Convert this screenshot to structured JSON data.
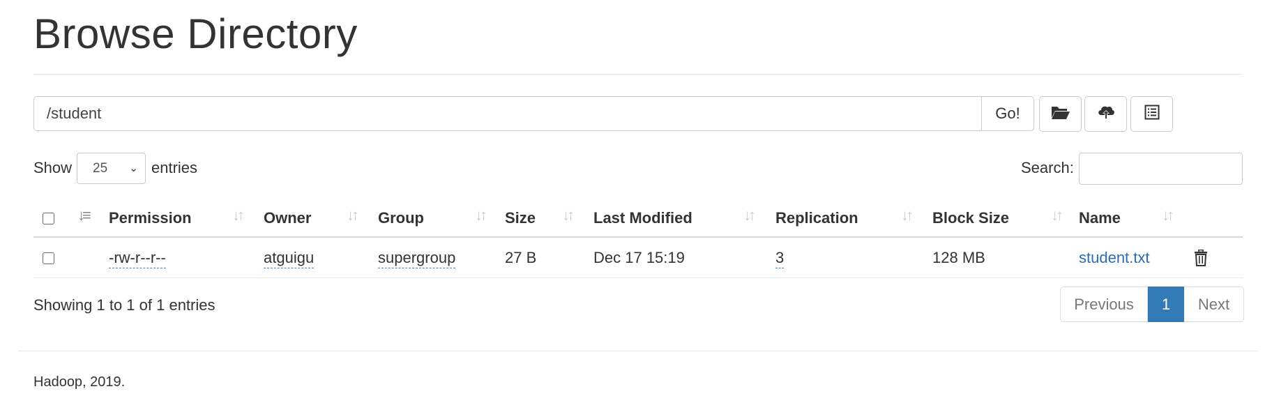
{
  "page_title": "Browse Directory",
  "path_bar": {
    "value": "/student",
    "go_label": "Go!"
  },
  "toolbar": {
    "icons": [
      "folder-open-icon",
      "cloud-upload-icon",
      "list-alt-icon"
    ]
  },
  "length_control": {
    "show_label": "Show",
    "selected": "25",
    "entries_label": "entries"
  },
  "search": {
    "label": "Search:",
    "value": ""
  },
  "table": {
    "columns": [
      "Permission",
      "Owner",
      "Group",
      "Size",
      "Last Modified",
      "Replication",
      "Block Size",
      "Name"
    ],
    "rows": [
      {
        "permission": "-rw-r--r--",
        "owner": "atguigu",
        "group": "supergroup",
        "size": "27 B",
        "last_modified": "Dec 17 15:19",
        "replication": "3",
        "block_size": "128 MB",
        "name": "student.txt"
      }
    ]
  },
  "info": "Showing 1 to 1 of 1 entries",
  "pagination": {
    "previous": "Previous",
    "current": "1",
    "next": "Next"
  },
  "footer": "Hadoop, 2019.",
  "colors": {
    "primary": "#337ab7",
    "link": "#2a6db3"
  }
}
